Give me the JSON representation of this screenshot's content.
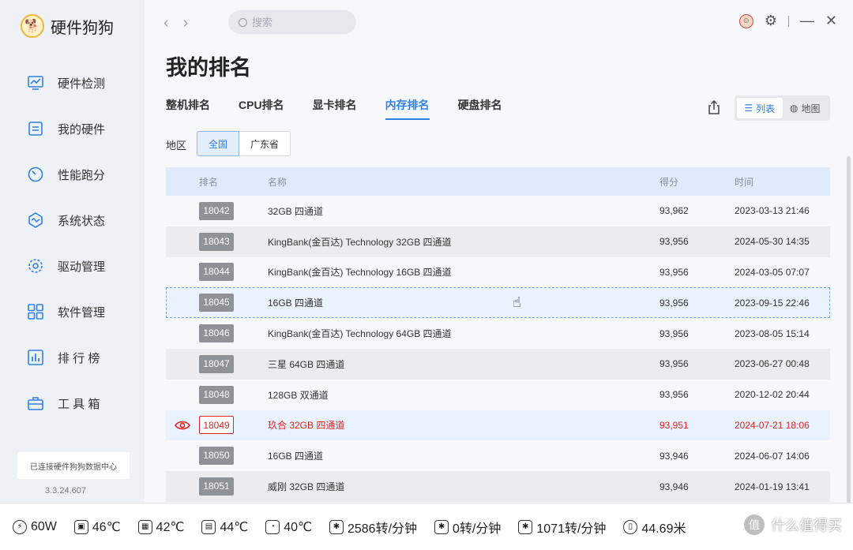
{
  "app": {
    "name": "硬件狗狗"
  },
  "sidebar": {
    "items": [
      {
        "label": "硬件检测",
        "icon": "monitor-icon"
      },
      {
        "label": "我的硬件",
        "icon": "chip-icon"
      },
      {
        "label": "性能跑分",
        "icon": "gauge-icon"
      },
      {
        "label": "系统状态",
        "icon": "pulse-icon"
      },
      {
        "label": "驱动管理",
        "icon": "gear-icon"
      },
      {
        "label": "软件管理",
        "icon": "apps-icon"
      },
      {
        "label": "排 行 榜",
        "icon": "chart-icon"
      },
      {
        "label": "工 具 箱",
        "icon": "toolbox-icon"
      }
    ],
    "connection": "已连接硬件狗狗数据中心",
    "version": "3.3.24.607"
  },
  "topbar": {
    "search_placeholder": "搜索"
  },
  "page": {
    "title": "我的排名",
    "tabs": [
      "整机排名",
      "CPU排名",
      "显卡排名",
      "内存排名",
      "硬盘排名"
    ],
    "active_tab": "内存排名",
    "view": {
      "list": "列表",
      "map": "地图",
      "active": "列表"
    },
    "region_label": "地区",
    "regions": [
      "全国",
      "广东省"
    ],
    "active_region": "全国"
  },
  "table": {
    "headers": {
      "rank": "排名",
      "name": "名称",
      "score": "得分",
      "time": "时间"
    },
    "rows": [
      {
        "rank": "18042",
        "name": "32GB 四通道",
        "score": "93,962",
        "time": "2023-03-13 21:46"
      },
      {
        "rank": "18043",
        "name": "KingBank(金百达) Technology 32GB 四通道",
        "score": "93,956",
        "time": "2024-05-30 14:35"
      },
      {
        "rank": "18044",
        "name": "KingBank(金百达) Technology 16GB 四通道",
        "score": "93,956",
        "time": "2024-03-05 07:07"
      },
      {
        "rank": "18045",
        "name": "16GB 四通道",
        "score": "93,956",
        "time": "2023-09-15 22:46"
      },
      {
        "rank": "18046",
        "name": "KingBank(金百达) Technology 64GB 四通道",
        "score": "93,956",
        "time": "2023-08-05 15:14"
      },
      {
        "rank": "18047",
        "name": "三星 64GB 四通道",
        "score": "93,956",
        "time": "2023-06-27 00:48"
      },
      {
        "rank": "18048",
        "name": "128GB 双通道",
        "score": "93,956",
        "time": "2020-12-02 20:44"
      },
      {
        "rank": "18049",
        "name": "玖合 32GB 四通道",
        "score": "93,951",
        "time": "2024-07-21 18:06"
      },
      {
        "rank": "18050",
        "name": "16GB 四通道",
        "score": "93,946",
        "time": "2024-06-07 14:06"
      },
      {
        "rank": "18051",
        "name": "威刚 32GB 四通道",
        "score": "93,946",
        "time": "2024-01-19 13:41"
      }
    ],
    "my_rank": "18049",
    "hovered_rank": "18045"
  },
  "status": {
    "power": "60W",
    "cpu_temp": "46℃",
    "board_temp": "42℃",
    "gpu_temp": "44℃",
    "disk_temp": "40℃",
    "fan1": "2586转/分钟",
    "fan2": "0转/分钟",
    "fan3": "1071转/分钟",
    "mouse_distance": "44.69米"
  },
  "watermark": {
    "text": "什么值得买",
    "logo": "值"
  },
  "colors": {
    "accent": "#2f80ed",
    "mine": "#e02424",
    "badge": "#8f9398"
  }
}
